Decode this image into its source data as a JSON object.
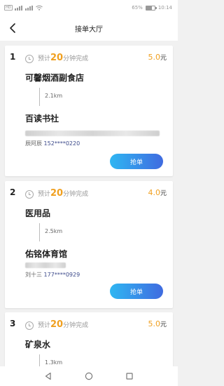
{
  "status_bar": {
    "battery": "65%",
    "time": "10:14",
    "battery_level": 0.65
  },
  "header": {
    "title": "接单大厅"
  },
  "common": {
    "eta_prefix": "预计",
    "eta_suffix": "分钟完成",
    "currency": "元",
    "grab_label": "抢单"
  },
  "orders": [
    {
      "index": "1",
      "eta_minutes": "20",
      "price": "5.0",
      "shop": "可馨烟酒副食店",
      "distance": "2.1km",
      "destination": "百读书社",
      "contact_name": "辰阿辰",
      "contact_phone": "152****0220"
    },
    {
      "index": "2",
      "eta_minutes": "20",
      "price": "4.0",
      "shop": "医用品",
      "distance": "2.5km",
      "destination": "佑铭体育馆",
      "contact_name": "刘十三",
      "contact_phone": "177****0929"
    },
    {
      "index": "3",
      "eta_minutes": "20",
      "price": "5.0",
      "shop": "矿泉水",
      "distance": "1.3km"
    }
  ]
}
